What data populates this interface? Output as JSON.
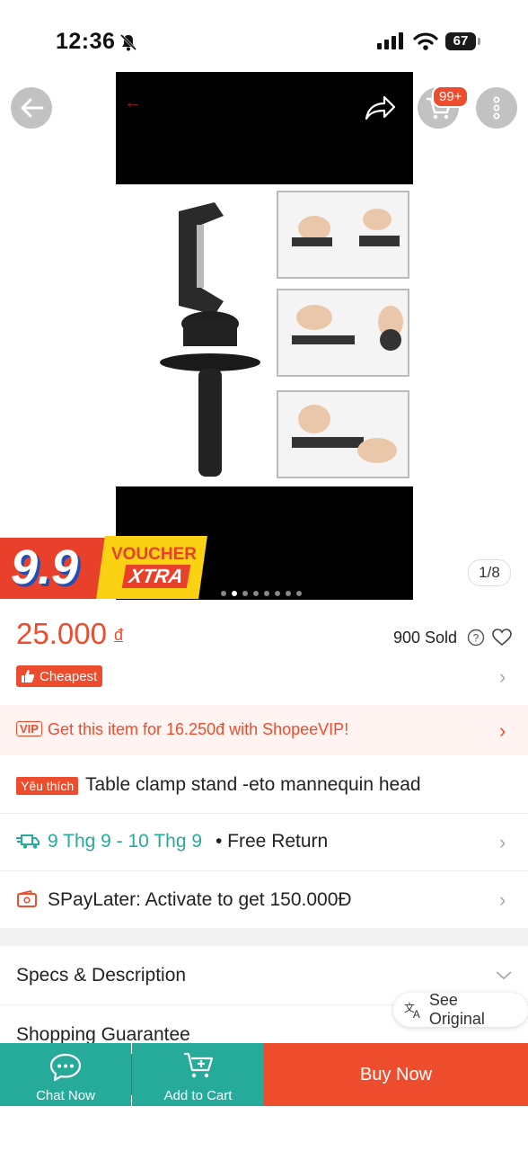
{
  "status_bar": {
    "time": "12:36",
    "battery": "67"
  },
  "header": {
    "cart_badge": "99+"
  },
  "gallery": {
    "counter": "1/8",
    "dot_count": 8,
    "active_dot": 1
  },
  "banner": {
    "big_text": "9.9",
    "voucher": "VOUCHER",
    "xtra": "XTRA"
  },
  "price": {
    "amount": "25.000",
    "currency": "đ",
    "sold": "900 Sold"
  },
  "badge": {
    "cheapest": "Cheapest"
  },
  "vip": {
    "badge": "VIP",
    "text": "Get this item for 16.250đ with ShopeeVIP!"
  },
  "product": {
    "fav_badge": "Yêu thích",
    "title": "Table clamp stand -eto mannequin head"
  },
  "shipping": {
    "date_range": "9 Thg 9 - 10 Thg 9",
    "extra": "• Free Return"
  },
  "spaylater": {
    "text": "SPayLater: Activate to get 150.000Đ"
  },
  "sections": {
    "specs": "Specs & Description",
    "guarantee": "Shopping Guarantee"
  },
  "translate": {
    "label": "See Original"
  },
  "bottom_bar": {
    "chat": "Chat Now",
    "add_to_cart": "Add to Cart",
    "buy_now": "Buy Now"
  },
  "colors": {
    "brand": "#ee4d2d",
    "teal": "#26aa99"
  }
}
